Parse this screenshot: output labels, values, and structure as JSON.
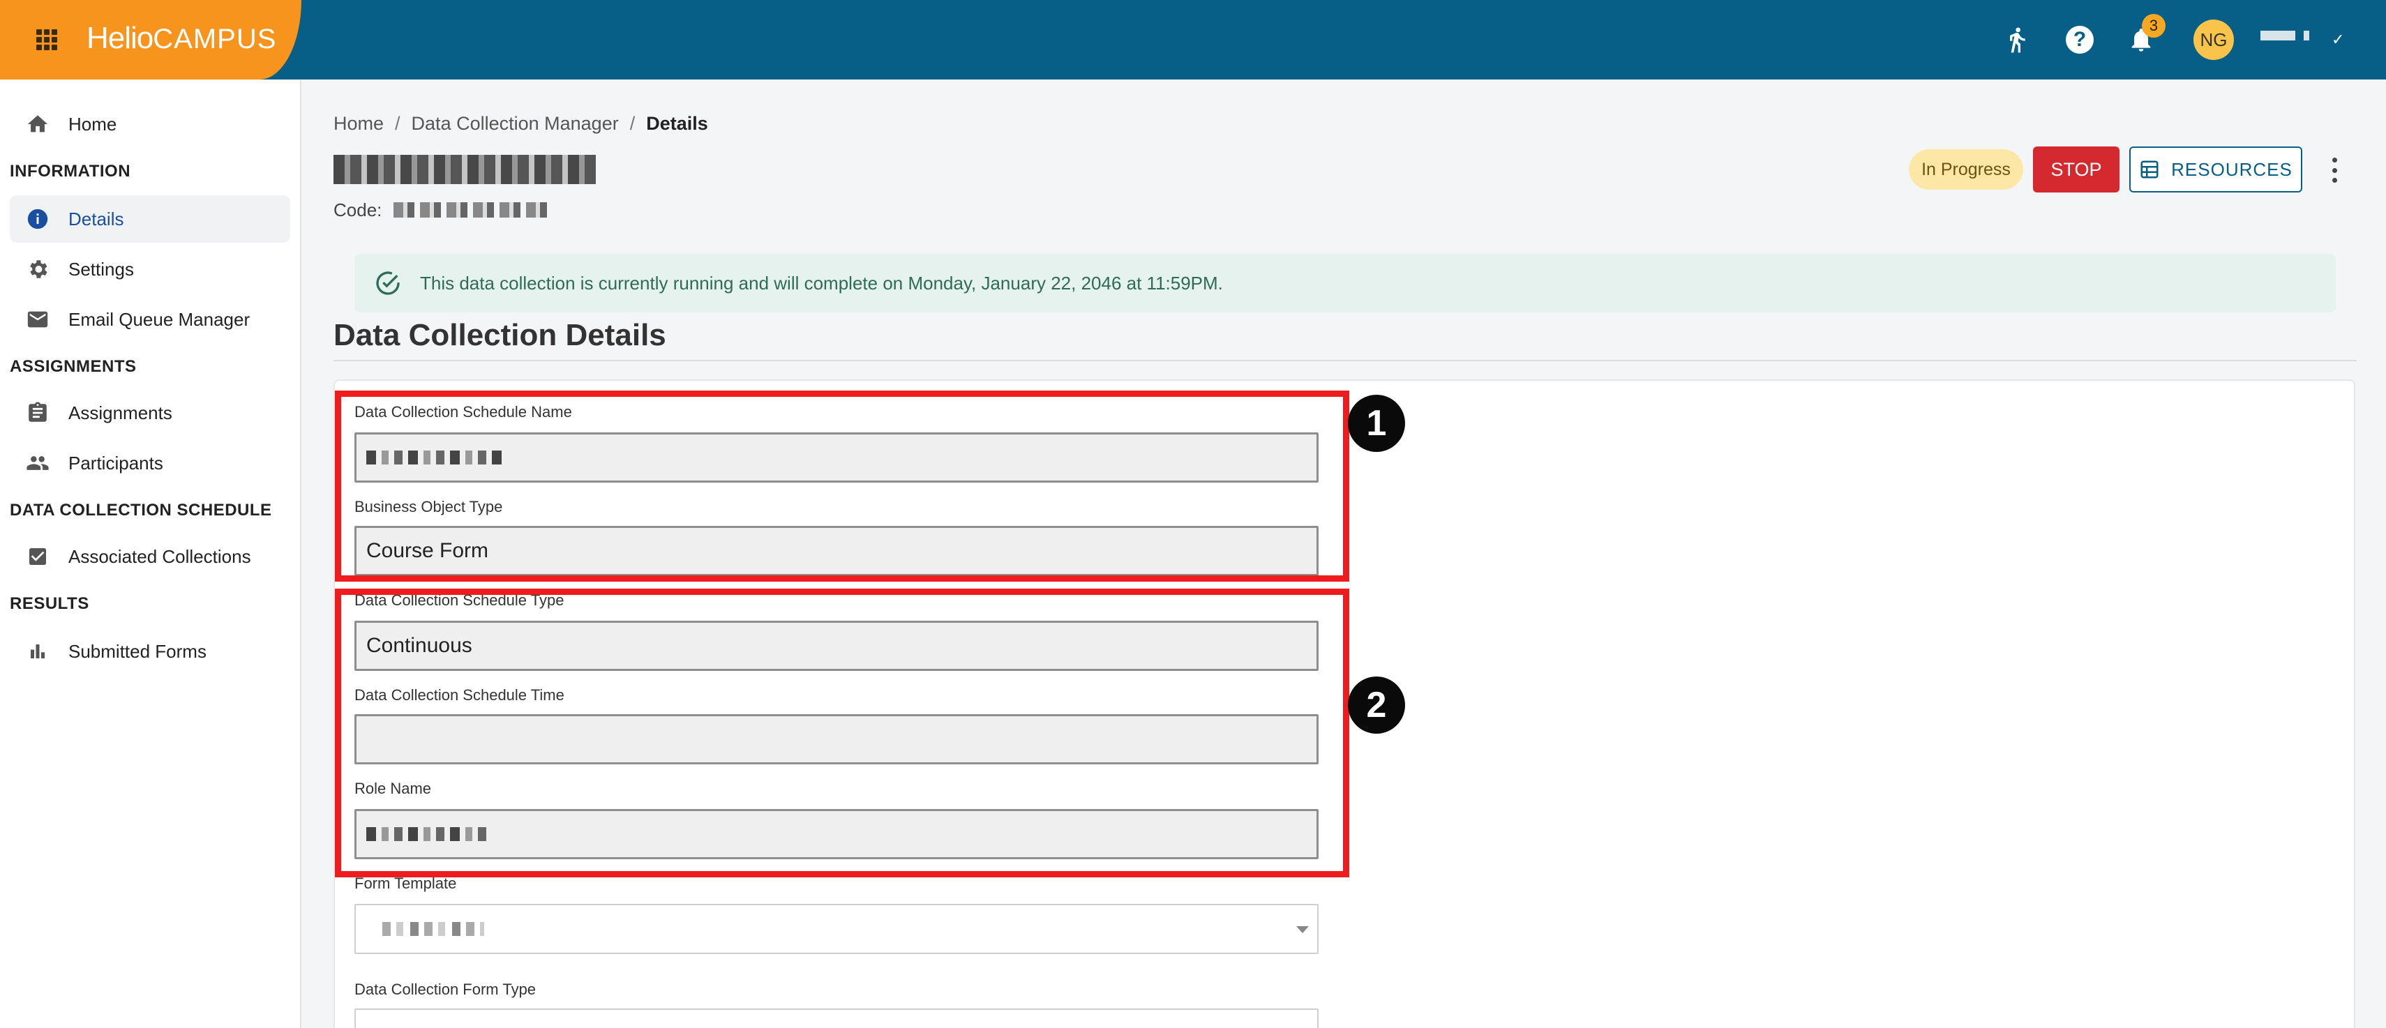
{
  "header": {
    "logo_primary": "Helio",
    "logo_secondary": "CAMPUS",
    "notifications_count": "3",
    "avatar_initials": "NG"
  },
  "sidebar": {
    "home": "Home",
    "section_information": "INFORMATION",
    "details": "Details",
    "settings": "Settings",
    "email_queue": "Email Queue Manager",
    "section_assignments": "ASSIGNMENTS",
    "assignments": "Assignments",
    "participants": "Participants",
    "section_dcs": "DATA COLLECTION SCHEDULE",
    "associated": "Associated Collections",
    "section_results": "RESULTS",
    "submitted": "Submitted Forms"
  },
  "breadcrumb": {
    "home": "Home",
    "sep": "/",
    "manager": "Data Collection Manager",
    "current": "Details"
  },
  "page": {
    "code_label": "Code:",
    "status": "In Progress",
    "stop_label": "STOP",
    "resources_label": "RESOURCES",
    "alert_text": "This data collection is currently running and will complete on Monday, January 22, 2046 at 11:59PM.",
    "section_title": "Data Collection Details"
  },
  "form": {
    "schedule_name_label": "Data Collection Schedule Name",
    "business_object_label": "Business Object Type",
    "business_object_value": "Course Form",
    "schedule_type_label": "Data Collection Schedule Type",
    "schedule_type_value": "Continuous",
    "schedule_time_label": "Data Collection Schedule Time",
    "schedule_time_value": "",
    "role_name_label": "Role Name",
    "form_template_label": "Form Template",
    "form_type_label": "Data Collection Form Type"
  },
  "markers": {
    "one": "1",
    "two": "2"
  },
  "colors": {
    "topbar": "#075e86",
    "brand": "#f7941d",
    "stop": "#d42a2f",
    "highlight": "#ee1c1c"
  }
}
